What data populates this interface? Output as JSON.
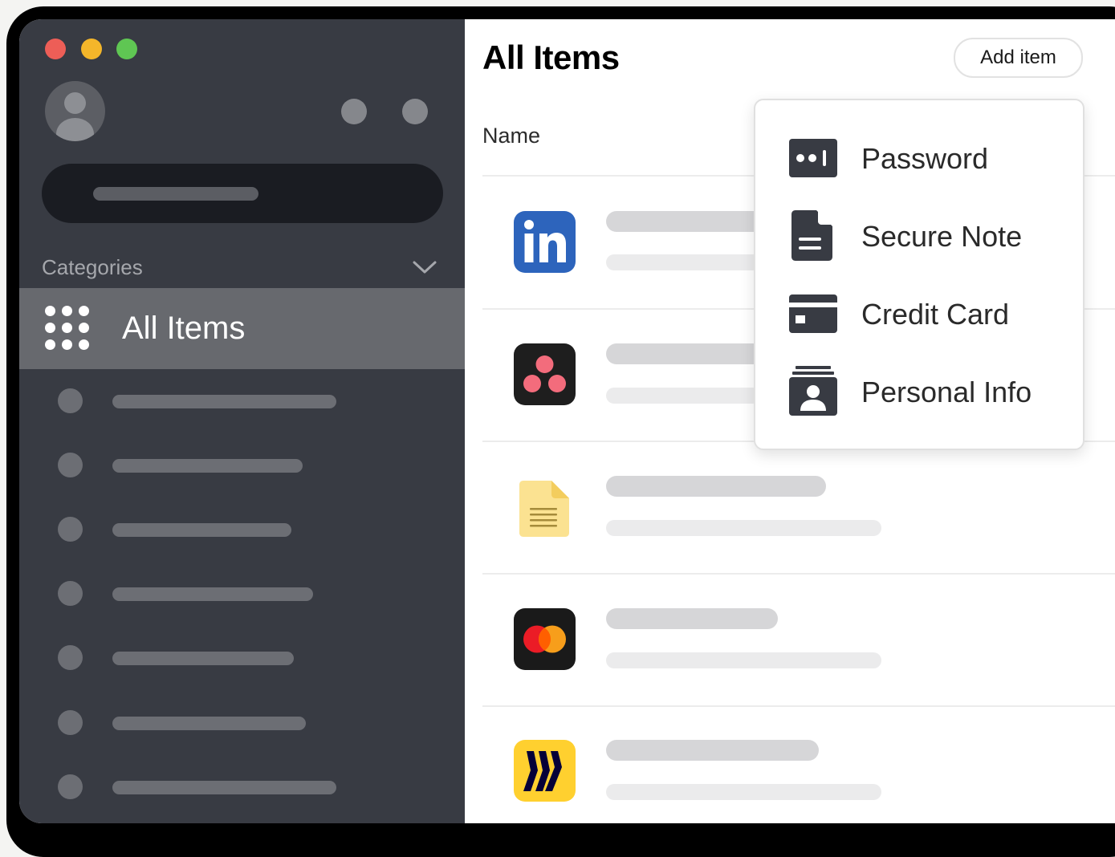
{
  "colors": {
    "traffic_close": "#ed5e57",
    "traffic_minimize": "#f4b62a",
    "traffic_zoom": "#5fc653",
    "sidebar_bg": "#383b43",
    "sidebar_selected_bg": "#67696e",
    "search_bg": "#1a1c22",
    "icon_dark": "#383b43"
  },
  "sidebar": {
    "categories_label": "Categories",
    "selected_item_label": "All Items",
    "selected_item_icon": "grid-icon",
    "placeholder_item_count": 7
  },
  "main": {
    "title": "All Items",
    "add_button_label": "Add item",
    "column_header": "Name",
    "items": [
      {
        "icon": "linkedin-icon"
      },
      {
        "icon": "asana-icon"
      },
      {
        "icon": "note-icon"
      },
      {
        "icon": "mastercard-icon"
      },
      {
        "icon": "miro-icon"
      }
    ]
  },
  "add_menu": {
    "items": [
      {
        "label": "Password",
        "icon": "password-icon"
      },
      {
        "label": "Secure Note",
        "icon": "document-icon"
      },
      {
        "label": "Credit Card",
        "icon": "credit-card-icon"
      },
      {
        "label": "Personal Info",
        "icon": "identity-card-icon"
      }
    ]
  }
}
